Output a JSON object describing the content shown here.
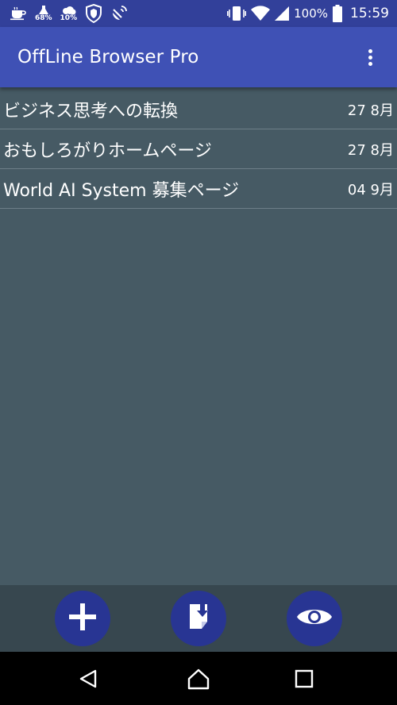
{
  "status_bar": {
    "icons": [
      "cup-icon",
      "lab-flask-icon",
      "weather-icon",
      "shield-icon",
      "satellite-dish-icon"
    ],
    "flask_percent": "68%",
    "weather_percent": "10%",
    "right_icons": [
      "vibrate-icon",
      "wifi-icon",
      "signal-icon",
      "battery-icon"
    ],
    "battery": "100%",
    "time": "15:59"
  },
  "app_bar": {
    "title": "OffLine Browser Pro",
    "menu_icon": "more-vert-icon"
  },
  "pages": [
    {
      "title": "ビジネス思考への転換",
      "date": "27 8月"
    },
    {
      "title": "おもしろがりホームページ",
      "date": "27 8月"
    },
    {
      "title": "World AI System 募集ページ",
      "date": "04 9月"
    }
  ],
  "bottom_actions": [
    {
      "name": "add-page-button",
      "icon": "plus-icon"
    },
    {
      "name": "download-button",
      "icon": "download-page-icon"
    },
    {
      "name": "view-button",
      "icon": "eye-icon"
    }
  ],
  "nav_bar": {
    "icons": [
      "back-icon",
      "home-icon",
      "recents-icon"
    ]
  },
  "colors": {
    "status_bar": "#32409a",
    "app_bar": "#3f51b5",
    "background": "#465a64",
    "bottom_bar": "#37474f",
    "fab": "#283593"
  }
}
